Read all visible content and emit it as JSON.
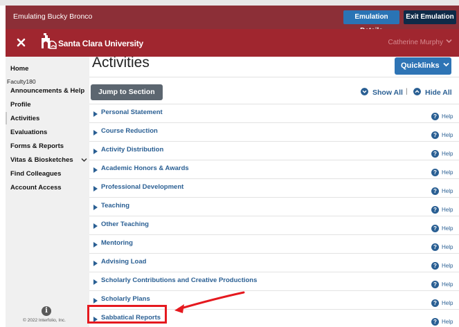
{
  "emulation": {
    "title": "Emulating Bucky Bronco",
    "details_label": "Emulation Details",
    "exit_label": "Exit Emulation"
  },
  "header": {
    "brand": "Santa Clara University",
    "user_name": "Catherine Murphy"
  },
  "sidebar": {
    "home": "Home",
    "group": "Faculty180",
    "items": [
      "Announcements & Help",
      "Profile",
      "Activities",
      "Evaluations",
      "Forms & Reports",
      "Vitas & Biosketches",
      "Find Colleagues",
      "Account Access"
    ],
    "copyright": "© 2022 Interfolio, Inc."
  },
  "main": {
    "title": "Activities",
    "quicklinks_label": "Quicklinks",
    "jump_label": "Jump to Section",
    "show_all_label": "Show All",
    "separator": "|",
    "hide_all_label": "Hide All",
    "help_label": "Help",
    "sections": [
      "Personal Statement",
      "Course Reduction",
      "Activity Distribution",
      "Academic Honors & Awards",
      "Professional Development",
      "Teaching",
      "Other Teaching",
      "Mentoring",
      "Advising Load",
      "Scholarly Contributions and Creative Productions",
      "Scholarly Plans",
      "Sabbatical Reports"
    ]
  },
  "colors": {
    "emulation_bar": "#8c2f37",
    "header_bar": "#a0262f",
    "link_blue": "#2a5f93",
    "button_blue": "#2e74b5",
    "annotation_red": "#e5191f"
  }
}
